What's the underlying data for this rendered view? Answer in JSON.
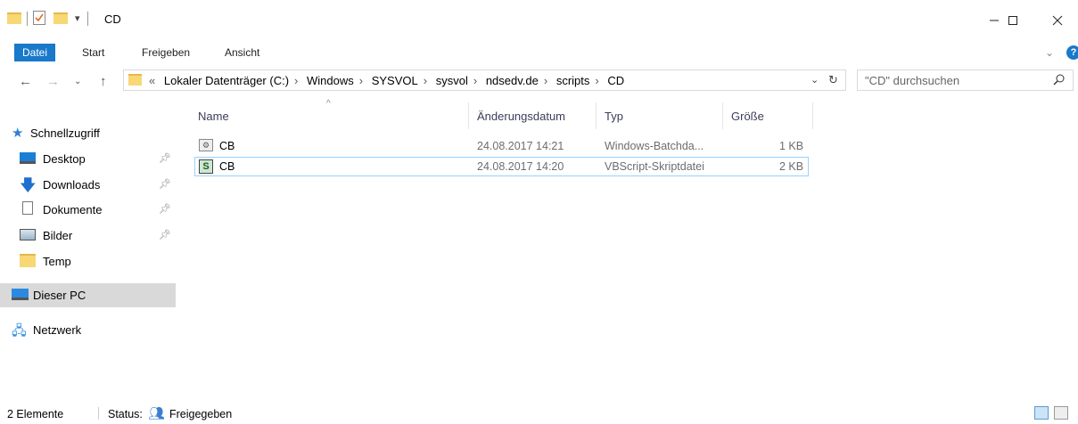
{
  "window": {
    "title": "CD",
    "minimize": "—",
    "maximize": "☐",
    "close": "✕"
  },
  "ribbon": {
    "tabs": [
      "Datei",
      "Start",
      "Freigeben",
      "Ansicht"
    ]
  },
  "address": {
    "overflow": "«",
    "crumbs": [
      "Lokaler Datenträger (C:)",
      "Windows",
      "SYSVOL",
      "sysvol",
      "ndsedv.de",
      "scripts",
      "CD"
    ],
    "search_placeholder": "\"CD\" durchsuchen"
  },
  "nav": {
    "quick_access": "Schnellzugriff",
    "items": [
      {
        "label": "Desktop",
        "pinned": true
      },
      {
        "label": "Downloads",
        "pinned": true
      },
      {
        "label": "Dokumente",
        "pinned": true
      },
      {
        "label": "Bilder",
        "pinned": true
      },
      {
        "label": "Temp",
        "pinned": false
      }
    ],
    "this_pc": "Dieser PC",
    "network": "Netzwerk"
  },
  "columns": [
    "Name",
    "Änderungsdatum",
    "Typ",
    "Größe"
  ],
  "files": [
    {
      "name": "CB",
      "date": "24.08.2017 14:21",
      "type": "Windows-Batchda...",
      "size": "1 KB",
      "icon": "batch-file-icon"
    },
    {
      "name": "CB",
      "date": "24.08.2017 14:20",
      "type": "VBScript-Skriptdatei",
      "size": "2 KB",
      "icon": "vbscript-file-icon"
    }
  ],
  "status": {
    "count": "2 Elemente",
    "label": "Status:",
    "state": "Freigegeben"
  },
  "colors": {
    "accent": "#1979ca",
    "selection_border": "#99d1ff",
    "nav_selected": "#d9d9d9"
  }
}
